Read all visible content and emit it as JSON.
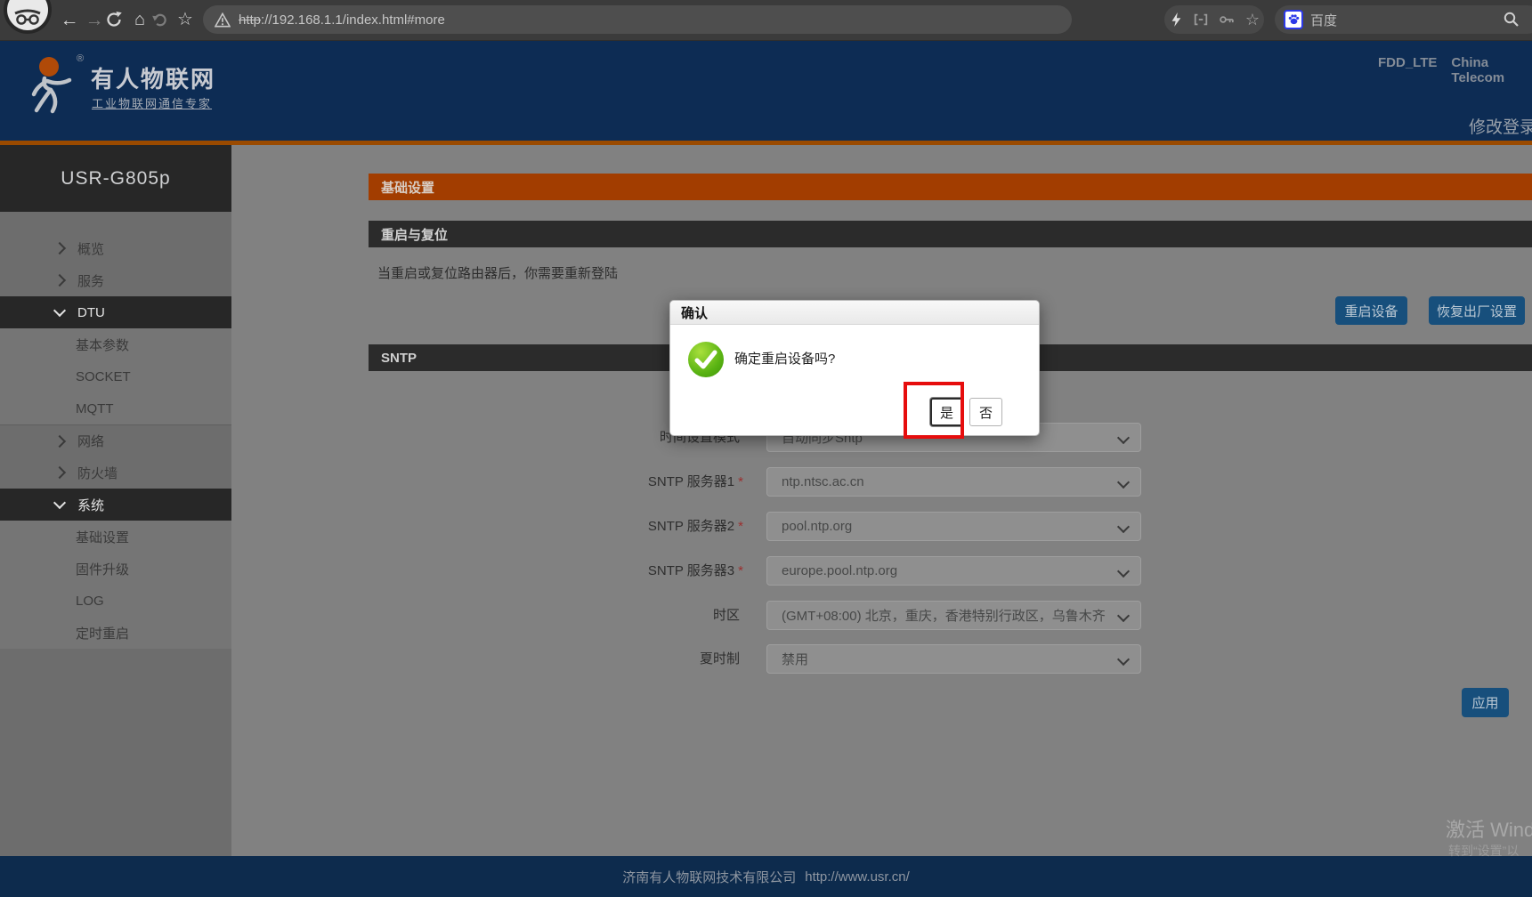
{
  "browser": {
    "back_icon": "←",
    "forward_icon": "→",
    "home_icon": "⌂",
    "star_icon": "☆",
    "url_scheme": "http",
    "url_rest": "://192.168.1.1/index.html#more",
    "search_engine": "百度"
  },
  "header": {
    "brand": "有人物联网",
    "reg_mark": "®",
    "slogan": "工业物联网通信专家",
    "network_mode": "FDD_LTE",
    "carrier": "China Telecom",
    "change_password": "修改登录密码"
  },
  "sidebar": {
    "device_model": "USR-G805p",
    "items": [
      {
        "label": "概览"
      },
      {
        "label": "服务"
      },
      {
        "label": "DTU"
      },
      {
        "label": "基本参数"
      },
      {
        "label": "SOCKET"
      },
      {
        "label": "MQTT"
      },
      {
        "label": "网络"
      },
      {
        "label": "防火墙"
      },
      {
        "label": "系统"
      },
      {
        "label": "基础设置"
      },
      {
        "label": "固件升级"
      },
      {
        "label": "LOG"
      },
      {
        "label": "定时重启"
      }
    ]
  },
  "main": {
    "section_basic": "基础设置",
    "section_restart": "重启与复位",
    "restart_note": "当重启或复位路由器后，你需要重新登陆",
    "restart_button": "重启设备",
    "factory_reset_button": "恢复出厂设置",
    "section_sntp": "SNTP",
    "form": {
      "rows": [
        {
          "label": "时间设置模式",
          "required": "",
          "value": "自动同步Sntp"
        },
        {
          "label": "SNTP 服务器1",
          "required": "*",
          "value": "ntp.ntsc.ac.cn"
        },
        {
          "label": "SNTP 服务器2",
          "required": "*",
          "value": "pool.ntp.org"
        },
        {
          "label": "SNTP 服务器3",
          "required": "*",
          "value": "europe.pool.ntp.org"
        },
        {
          "label": "时区",
          "required": "",
          "value": "(GMT+08:00) 北京，重庆，香港特别行政区，乌鲁木齐"
        },
        {
          "label": "夏时制",
          "required": "",
          "value": "禁用"
        }
      ]
    },
    "apply_button": "应用"
  },
  "dialog": {
    "title": "确认",
    "message": "确定重启设备吗?",
    "yes_button": "是",
    "no_button": "否"
  },
  "footer": {
    "company": "济南有人物联网技术有限公司",
    "website": "http://www.usr.cn/"
  },
  "watermark": {
    "line1": "激活 Wind",
    "line2": "转到“设置”以"
  },
  "colors": {
    "header_navy": "#0d2c54",
    "accent_orange": "#9a4a00",
    "section_orange": "#a23d00",
    "button_blue": "#174f7c",
    "dialog_green": "#58b212",
    "annotation_red": "#e60d0d"
  }
}
